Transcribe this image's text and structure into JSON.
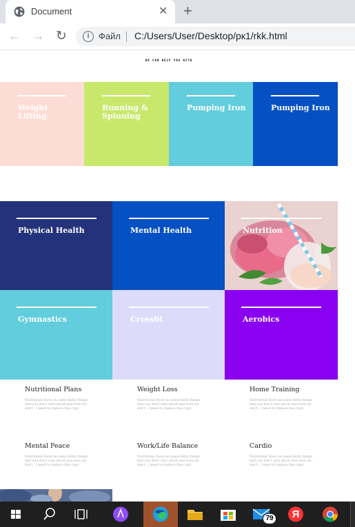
{
  "browser": {
    "tab_title": "Document",
    "close_glyph": "✕",
    "new_tab_glyph": "+",
    "back_glyph": "←",
    "forward_glyph": "→",
    "reload_glyph": "↻",
    "info_glyph": "i",
    "address_scheme": "Файл",
    "address_url": "C:/Users/User/Desktop/рк1/rkk.html"
  },
  "page": {
    "tagline": "WE CAN HELP YOU WITH",
    "top_tiles": [
      {
        "label": "Weight Lifting",
        "color": "#fddcd6"
      },
      {
        "label": "Running & Spinning",
        "color": "#c8e86b"
      },
      {
        "label": "Pumping Iron",
        "color": "#62cddc"
      },
      {
        "label": "Pumping Iron",
        "color": "#0550c2"
      }
    ],
    "grid_tiles": [
      {
        "label": "Physical Health",
        "color": "#23327a"
      },
      {
        "label": "Mental Health",
        "color": "#0550c2"
      },
      {
        "label": "Nutrition",
        "color": "#e8cccc"
      },
      {
        "label": "Gymnastics",
        "color": "#62cddc"
      },
      {
        "label": "Crossfit",
        "color": "#dcdcfa"
      },
      {
        "label": "Aerobics",
        "color": "#8a00f0"
      }
    ],
    "features": [
      {
        "heading": "Nutritional Plans",
        "text": "Nutritional Facts on some shitty things that you don't care about and even we don't , I need to replace this copy."
      },
      {
        "heading": "Weight Loss",
        "text": "Nutritional Facts on some shitty things that you don't care about and even we don't , I need to replace this copy."
      },
      {
        "heading": "Home Training",
        "text": "Nutritional Facts on some shitty things that you don't care about and even we don't , I need to replace this copy."
      },
      {
        "heading": "Mental Peace",
        "text": "Nutritional Facts on some shitty things that you don't care about and even we don't , I need to replace this copy."
      },
      {
        "heading": "Work/Life Balance",
        "text": "Nutritional Facts on some shitty things that you don't care about and even we don't , I need to replace this copy."
      },
      {
        "heading": "Cardio",
        "text": "Nutritional Facts on some shitty things that you don't care about and even we don't , I need to replace this copy."
      }
    ]
  },
  "taskbar": {
    "items": [
      "windows-start-icon",
      "search-icon",
      "task-view-icon",
      "alice-icon",
      "edge-icon",
      "file-explorer-icon",
      "store-icon",
      "mail-icon",
      "yandex-browser-icon",
      "chrome-icon"
    ],
    "mail_badge": "79",
    "yandex_glyph": "Я"
  }
}
